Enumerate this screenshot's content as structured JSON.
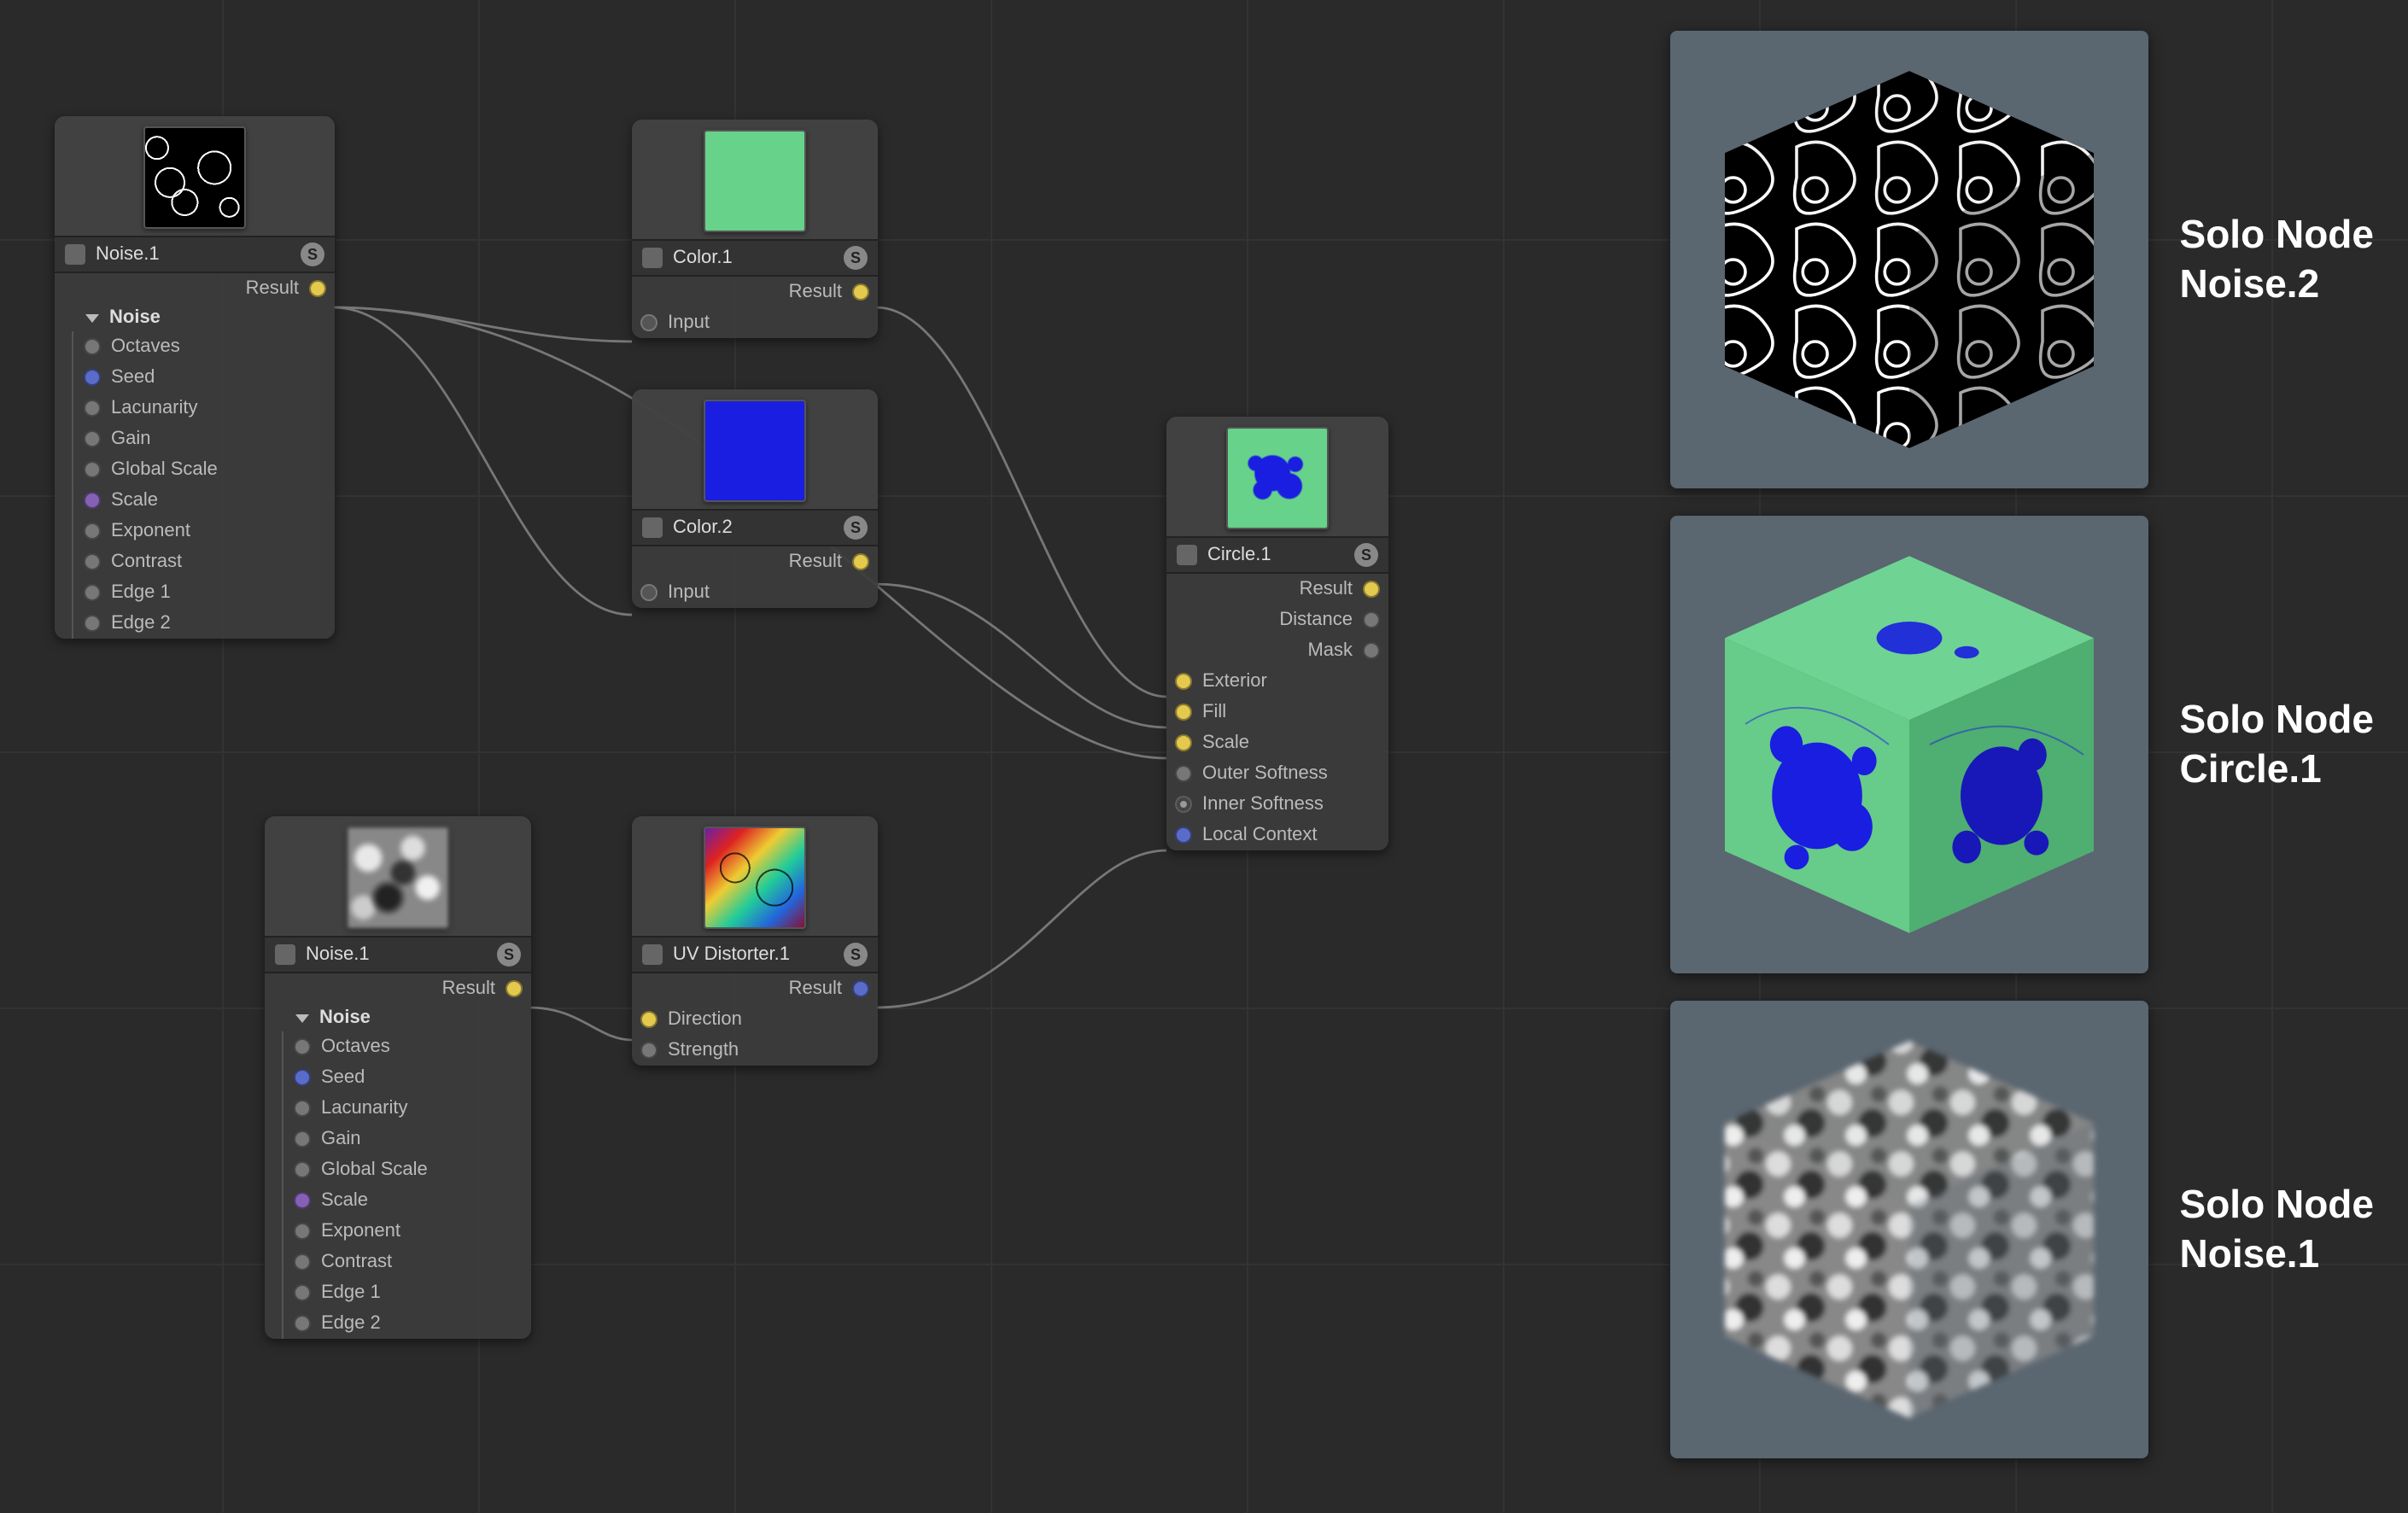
{
  "badge_letter": "S",
  "nodes": {
    "noise1": {
      "title": "Noise.1",
      "outputs": [
        {
          "label": "Result",
          "color": "y"
        }
      ],
      "group": "Noise",
      "params": [
        {
          "label": "Octaves",
          "color": "g"
        },
        {
          "label": "Seed",
          "color": "b"
        },
        {
          "label": "Lacunarity",
          "color": "g"
        },
        {
          "label": "Gain",
          "color": "g"
        },
        {
          "label": "Global Scale",
          "color": "g"
        },
        {
          "label": "Scale",
          "color": "p"
        },
        {
          "label": "Exponent",
          "color": "g"
        },
        {
          "label": "Contrast",
          "color": "g"
        },
        {
          "label": "Edge 1",
          "color": "g"
        },
        {
          "label": "Edge 2",
          "color": "g"
        }
      ]
    },
    "noise2": {
      "title": "Noise.1",
      "outputs": [
        {
          "label": "Result",
          "color": "y"
        }
      ],
      "group": "Noise",
      "params": [
        {
          "label": "Octaves",
          "color": "g"
        },
        {
          "label": "Seed",
          "color": "b"
        },
        {
          "label": "Lacunarity",
          "color": "g"
        },
        {
          "label": "Gain",
          "color": "g"
        },
        {
          "label": "Global Scale",
          "color": "g"
        },
        {
          "label": "Scale",
          "color": "p"
        },
        {
          "label": "Exponent",
          "color": "g"
        },
        {
          "label": "Contrast",
          "color": "g"
        },
        {
          "label": "Edge 1",
          "color": "g"
        },
        {
          "label": "Edge 2",
          "color": "g"
        }
      ]
    },
    "color1": {
      "title": "Color.1",
      "outputs": [
        {
          "label": "Result",
          "color": "y"
        }
      ],
      "inputs": [
        {
          "label": "Input",
          "color": "empty"
        }
      ]
    },
    "color2": {
      "title": "Color.2",
      "outputs": [
        {
          "label": "Result",
          "color": "y"
        }
      ],
      "inputs": [
        {
          "label": "Input",
          "color": "empty"
        }
      ]
    },
    "uvdist": {
      "title": "UV Distorter.1",
      "outputs": [
        {
          "label": "Result",
          "color": "b"
        }
      ],
      "inputs": [
        {
          "label": "Direction",
          "color": "y"
        },
        {
          "label": "Strength",
          "color": "g"
        }
      ]
    },
    "circle": {
      "title": "Circle.1",
      "outputs": [
        {
          "label": "Result",
          "color": "y"
        },
        {
          "label": "Distance",
          "color": "g"
        },
        {
          "label": "Mask",
          "color": "g"
        }
      ],
      "inputs": [
        {
          "label": "Exterior",
          "color": "y"
        },
        {
          "label": "Fill",
          "color": "y"
        },
        {
          "label": "Scale",
          "color": "y"
        },
        {
          "label": "Outer Softness",
          "color": "g"
        },
        {
          "label": "Inner Softness",
          "color": "dot"
        },
        {
          "label": "Local Context",
          "color": "b"
        }
      ]
    }
  },
  "previews": [
    {
      "label_line1": "Solo Node",
      "label_line2": "Noise.2"
    },
    {
      "label_line1": "Solo Node",
      "label_line2": "Circle.1"
    },
    {
      "label_line1": "Solo Node",
      "label_line2": "Noise.1"
    }
  ]
}
